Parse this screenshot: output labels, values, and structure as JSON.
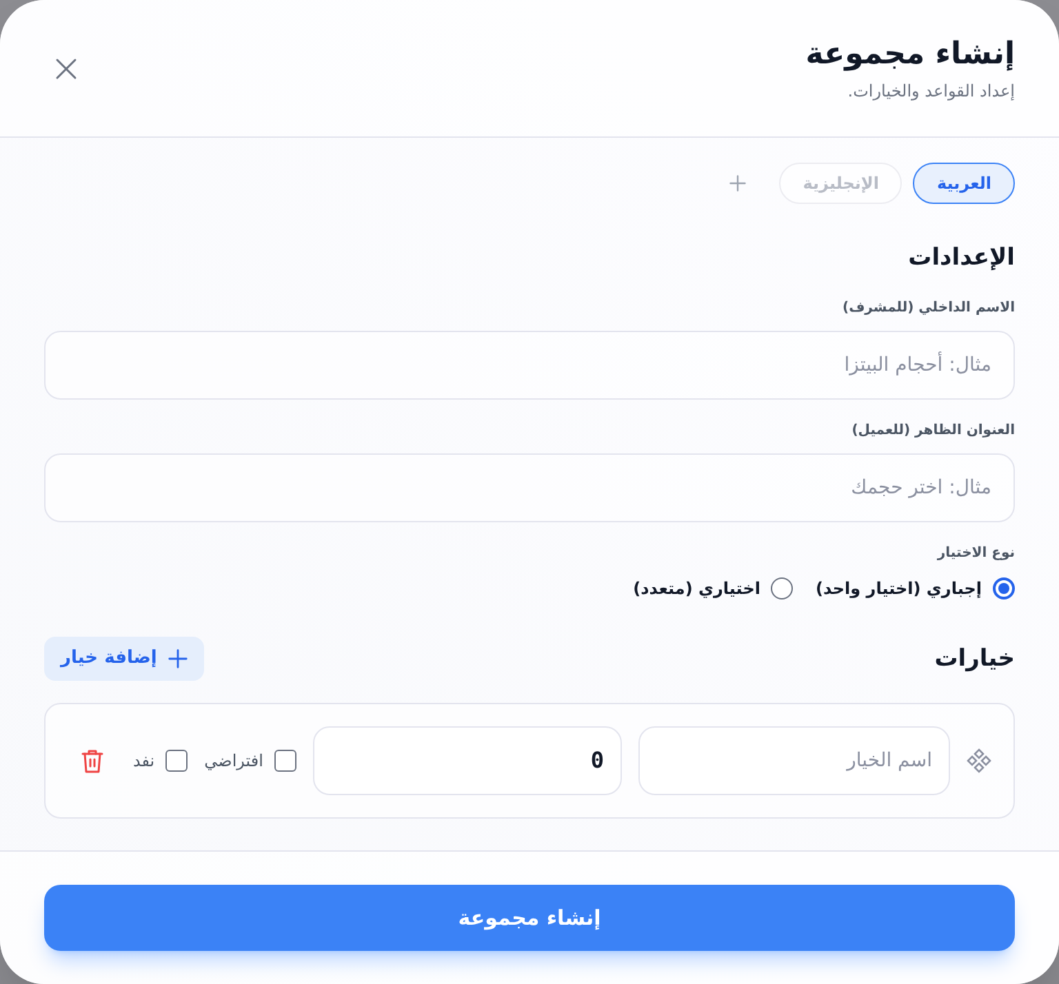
{
  "dialog": {
    "title": "إنشاء مجموعة",
    "subtitle": "إعداد القواعد والخيارات."
  },
  "language_tabs": [
    {
      "label": "العربية",
      "selected": true
    },
    {
      "label": "الإنجليزية",
      "selected": false
    }
  ],
  "settings": {
    "heading": "الإعدادات",
    "fields": [
      {
        "label": "الاسم الداخلي (للمشرف)",
        "placeholder": "مثال: أحجام البيتزا"
      },
      {
        "label": "العنوان الظاهر (للعميل)",
        "placeholder": "مثال: اختر حجمك"
      }
    ],
    "selection_type": {
      "label": "نوع الاختيار",
      "options": [
        {
          "label": "إجباري (اختيار واحد)",
          "selected": true
        },
        {
          "label": "اختياري (متعدد)",
          "selected": false
        }
      ]
    }
  },
  "options": {
    "heading": "خيارات",
    "add_button": "إضافة خيار",
    "items": [
      {
        "name_placeholder": "اسم الخيار",
        "price": "0",
        "checkboxes": [
          {
            "label": "افتراضي",
            "checked": false
          },
          {
            "label": "نفد",
            "checked": false
          }
        ]
      }
    ]
  },
  "submit_button": "إنشاء مجموعة"
}
